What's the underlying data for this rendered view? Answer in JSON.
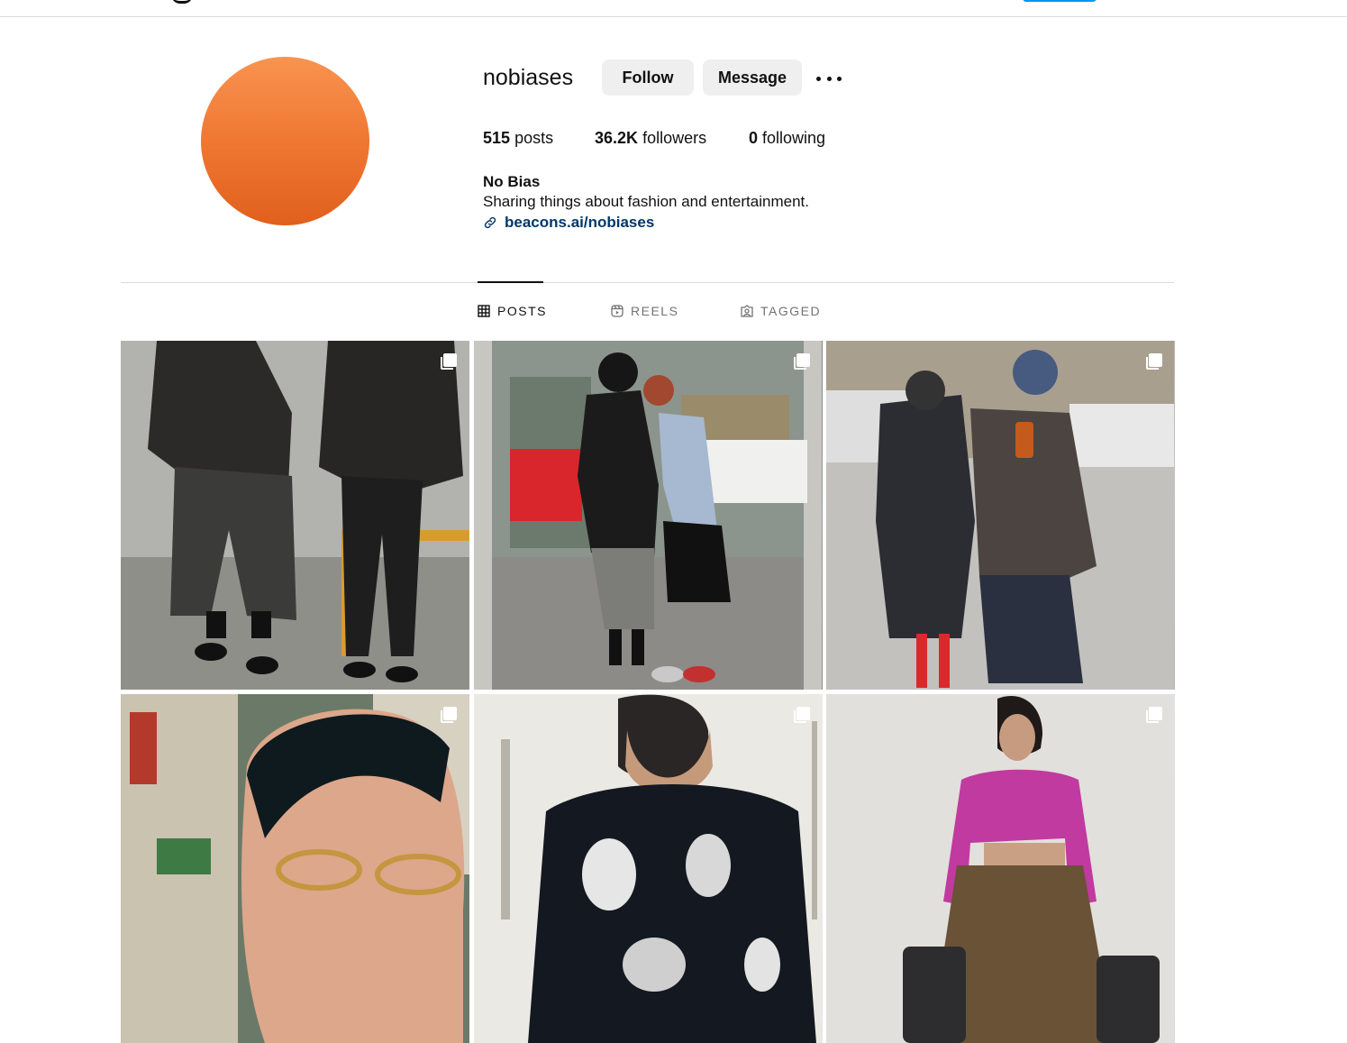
{
  "profile": {
    "username": "nobiases",
    "follow_label": "Follow",
    "message_label": "Message",
    "stats": {
      "posts_count": "515",
      "posts_label": "posts",
      "followers_count": "36.2K",
      "followers_label": "followers",
      "following_count": "0",
      "following_label": "following"
    },
    "full_name": "No Bias",
    "bio": "Sharing things about fashion and entertainment.",
    "link": "beacons.ai/nobiases",
    "avatar_color": "#f07a35"
  },
  "tabs": [
    {
      "label": "POSTS",
      "icon": "grid-icon",
      "active": true
    },
    {
      "label": "REELS",
      "icon": "reels-icon",
      "active": false
    },
    {
      "label": "TAGGED",
      "icon": "tagged-icon",
      "active": false
    }
  ],
  "posts": [
    {
      "type": "carousel",
      "icon": "multiple-posts-icon"
    },
    {
      "type": "carousel",
      "icon": "multiple-posts-icon"
    },
    {
      "type": "carousel",
      "icon": "multiple-posts-icon"
    },
    {
      "type": "carousel",
      "icon": "multiple-posts-icon"
    },
    {
      "type": "carousel",
      "icon": "multiple-posts-icon"
    },
    {
      "type": "carousel",
      "icon": "multiple-posts-icon"
    }
  ],
  "colors": {
    "link": "#00376b",
    "button_bg": "#efefef",
    "divider": "#dbdbdb",
    "accent": "#0095f6"
  }
}
